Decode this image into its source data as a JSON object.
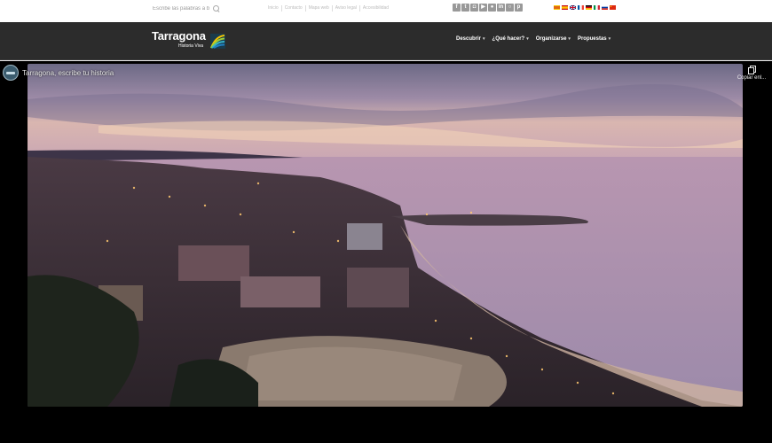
{
  "topbar": {
    "search_placeholder": "Escribe las palabras a bu",
    "links": [
      "Inicio",
      "Contacto",
      "Mapa web",
      "Aviso legal",
      "Accesibilidad"
    ],
    "social_icons": [
      "facebook-icon",
      "twitter-icon",
      "instagram-icon",
      "youtube-icon",
      "linkedin-icon",
      "pinterest-icon",
      "tripadvisor-icon"
    ],
    "languages": [
      {
        "name": "catalan-flag",
        "colors": [
          "#f7c600",
          "#d52b1e"
        ]
      },
      {
        "name": "spanish-flag",
        "colors": [
          "#c60b1e",
          "#ffc400"
        ]
      },
      {
        "name": "english-flag",
        "colors": [
          "#012169",
          "#c8102e"
        ]
      },
      {
        "name": "french-flag",
        "colors": [
          "#0055a4",
          "#ef4135"
        ]
      },
      {
        "name": "german-flag",
        "colors": [
          "#000000",
          "#dd0000"
        ]
      },
      {
        "name": "italian-flag",
        "colors": [
          "#009246",
          "#ce2b37"
        ]
      },
      {
        "name": "russian-flag",
        "colors": [
          "#0039a6",
          "#d52b1e"
        ]
      },
      {
        "name": "chinese-flag",
        "colors": [
          "#de2910",
          "#ffde00"
        ]
      }
    ]
  },
  "header": {
    "logo_name": "Tarragona",
    "logo_tagline": "Historia Viva",
    "nav": [
      "Descubrir",
      "¿Qué hacer?",
      "Organizarse",
      "Propuestas"
    ],
    "chevron": "▾"
  },
  "video": {
    "title": "Tarragona, escribe tu historia",
    "copy_label": "Copiar enl..."
  },
  "colors": {
    "header_bg": "#2c2c2c",
    "sky_top": "#6d6a86",
    "sea": "#a88da8"
  }
}
